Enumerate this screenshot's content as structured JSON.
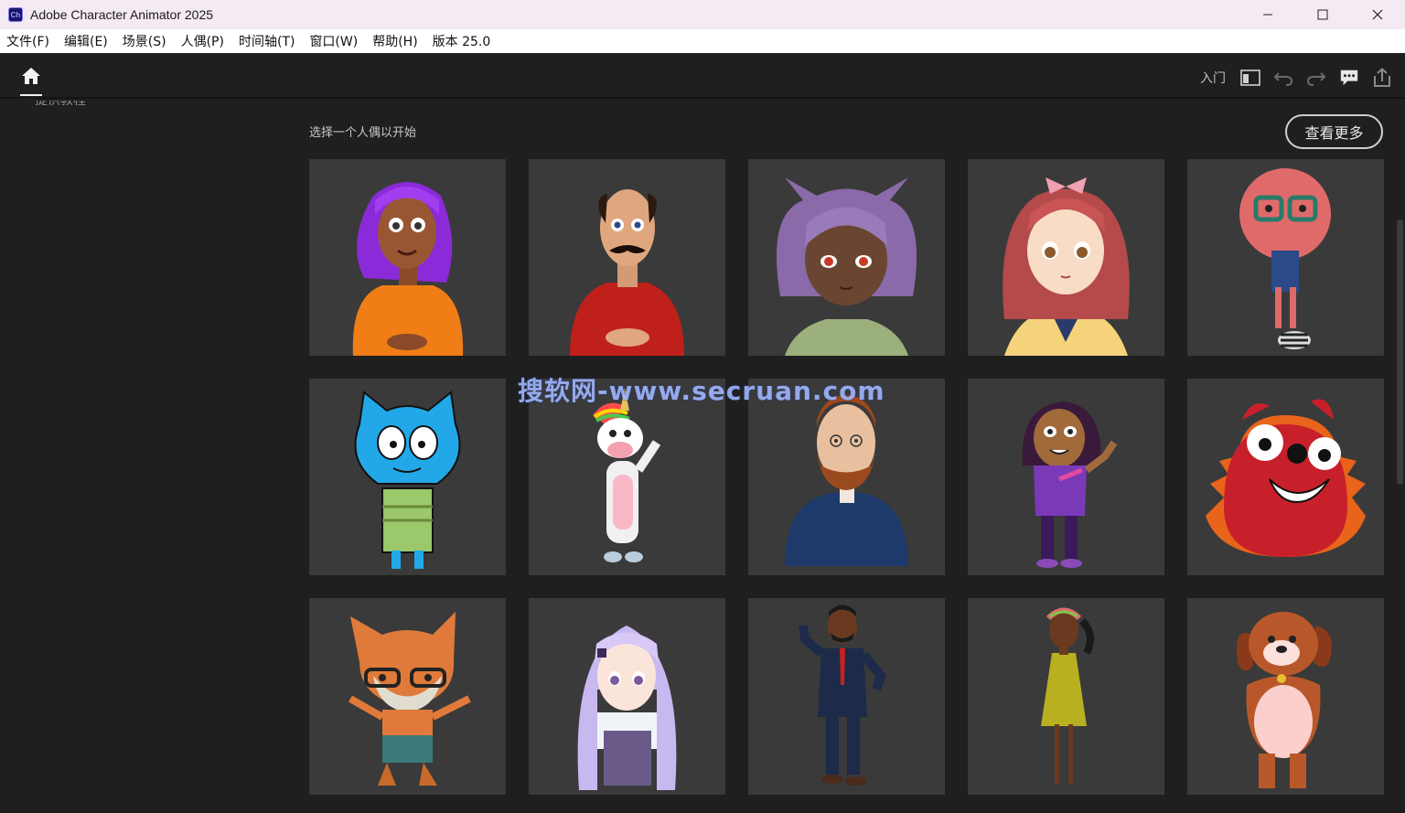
{
  "window": {
    "app_icon_text": "Ch",
    "title": "Adobe Character Animator 2025",
    "controls": [
      "minimize-icon",
      "maximize-icon",
      "close-icon"
    ]
  },
  "menu": {
    "items": [
      "文件(F)",
      "编辑(E)",
      "场景(S)",
      "人偶(P)",
      "时间轴(T)",
      "窗口(W)",
      "帮助(H)",
      "版本 25.0"
    ]
  },
  "toolbar": {
    "home_icon": "home-icon",
    "getting_started_label": "入门",
    "icons": [
      "panel-layout-icon",
      "undo-icon",
      "redo-icon",
      "feedback-icon",
      "share-export-icon"
    ]
  },
  "content": {
    "cut_off_text": "提供教程",
    "section_label": "选择一个人偶以开始",
    "see_more_label": "查看更多",
    "watermark": "搜软网-www.secruan.com"
  },
  "puppets": [
    {
      "id": "puppet-purple-hair-woman"
    },
    {
      "id": "puppet-mustache-man"
    },
    {
      "id": "puppet-anime-cat-girl"
    },
    {
      "id": "puppet-anime-red-hair-girl"
    },
    {
      "id": "puppet-red-monster-glasses"
    },
    {
      "id": "puppet-blue-cat"
    },
    {
      "id": "puppet-unicorn"
    },
    {
      "id": "puppet-bearded-man"
    },
    {
      "id": "puppet-girl-waving"
    },
    {
      "id": "puppet-red-blob-monster"
    },
    {
      "id": "puppet-fox-glasses"
    },
    {
      "id": "puppet-lavender-anime-girl"
    },
    {
      "id": "puppet-man-suit"
    },
    {
      "id": "puppet-girl-yellow-dress"
    },
    {
      "id": "puppet-brown-dog"
    }
  ]
}
